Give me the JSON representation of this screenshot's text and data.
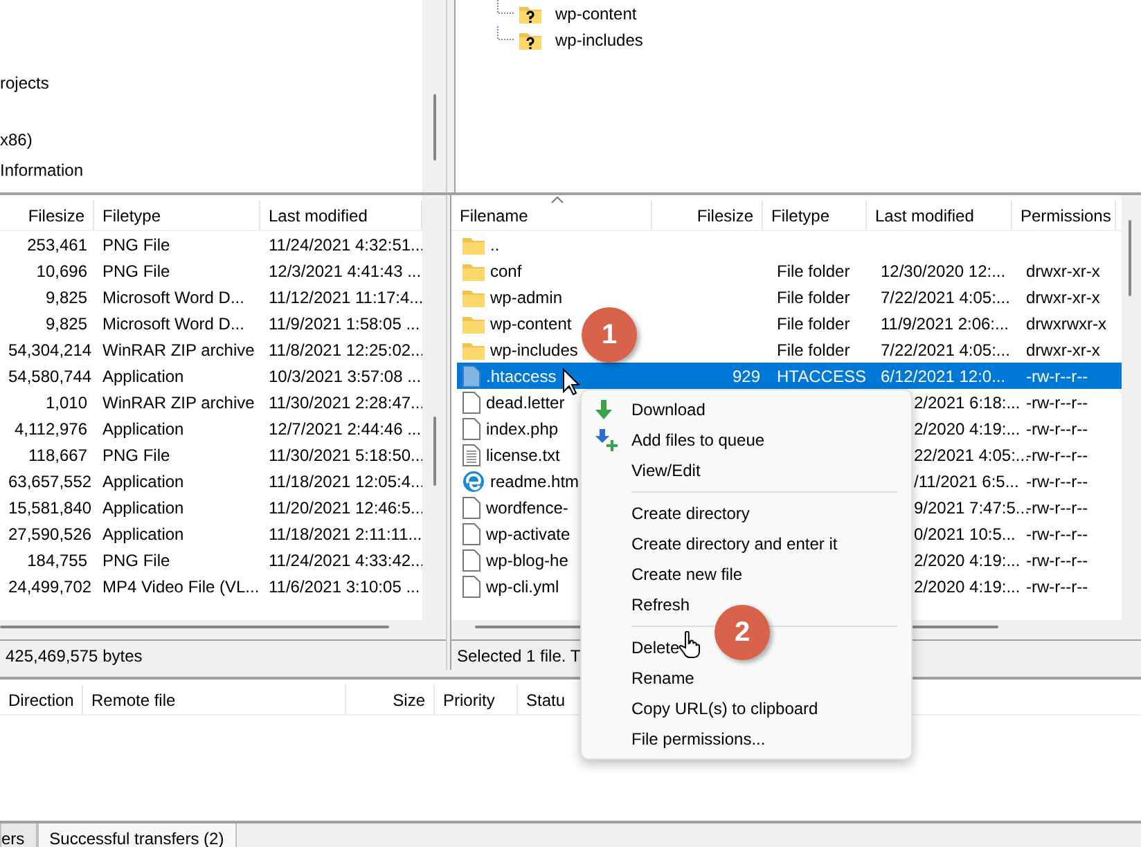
{
  "local_tree": {
    "items": [
      {
        "label": "rojects"
      },
      {
        "label": "x86)"
      },
      {
        "label": "Information"
      }
    ]
  },
  "remote_tree": {
    "items": [
      {
        "label": "wp-content"
      },
      {
        "label": "wp-includes"
      }
    ]
  },
  "local_list": {
    "columns": [
      "Filesize",
      "Filetype",
      "Last modified"
    ],
    "rows": [
      {
        "size": "253,461",
        "type": "PNG File",
        "modified": "11/24/2021 4:32:51..."
      },
      {
        "size": "10,696",
        "type": "PNG File",
        "modified": "12/3/2021 4:41:43 ..."
      },
      {
        "size": "9,825",
        "type": "Microsoft Word D...",
        "modified": "11/12/2021 11:17:4..."
      },
      {
        "size": "9,825",
        "type": "Microsoft Word D...",
        "modified": "11/9/2021 1:58:05 ..."
      },
      {
        "size": "54,304,214",
        "type": "WinRAR ZIP archive",
        "modified": "11/8/2021 12:25:02..."
      },
      {
        "size": "54,580,744",
        "type": "Application",
        "modified": "10/3/2021 3:57:08 ..."
      },
      {
        "size": "1,010",
        "type": "WinRAR ZIP archive",
        "modified": "11/30/2021 2:28:47..."
      },
      {
        "size": "4,112,976",
        "type": "Application",
        "modified": "12/7/2021 2:44:46 ..."
      },
      {
        "size": "118,667",
        "type": "PNG File",
        "modified": "11/30/2021 5:18:50..."
      },
      {
        "size": "63,657,552",
        "type": "Application",
        "modified": "11/18/2021 12:05:4..."
      },
      {
        "size": "15,581,840",
        "type": "Application",
        "modified": "11/20/2021 12:46:5..."
      },
      {
        "size": "27,590,526",
        "type": "Application",
        "modified": "11/18/2021 2:11:11..."
      },
      {
        "size": "184,755",
        "type": "PNG File",
        "modified": "11/24/2021 4:33:42..."
      },
      {
        "size": "24,499,702",
        "type": "MP4 Video File (VL...",
        "modified": "11/6/2021 3:10:05 ..."
      }
    ]
  },
  "local_status": "425,469,575 bytes",
  "remote_list": {
    "columns": [
      "Filename",
      "Filesize",
      "Filetype",
      "Last modified",
      "Permissions"
    ],
    "rows": [
      {
        "name": "..",
        "kind": "folder",
        "selected": false
      },
      {
        "name": "conf",
        "kind": "folder",
        "type": "File folder",
        "modified": "12/30/2020 12:...",
        "perms": "drwxr-xr-x",
        "selected": false
      },
      {
        "name": "wp-admin",
        "kind": "folder",
        "type": "File folder",
        "modified": "7/22/2021 4:05:...",
        "perms": "drwxr-xr-x",
        "selected": false
      },
      {
        "name": "wp-content",
        "kind": "folder",
        "type": "File folder",
        "modified": "11/9/2021 2:06:...",
        "perms": "drwxrwxr-x",
        "selected": false
      },
      {
        "name": "wp-includes",
        "kind": "folder",
        "type": "File folder",
        "modified": "7/22/2021 4:05:...",
        "perms": "drwxr-xr-x",
        "selected": false
      },
      {
        "name": ".htaccess",
        "kind": "config",
        "size": "929",
        "type": "HTACCESS",
        "modified": "6/12/2021 12:0...",
        "perms": "-rw-r--r--",
        "selected": true
      },
      {
        "name": "dead.letter",
        "kind": "file",
        "modified": "2/2021 6:18:...",
        "perms": "-rw-r--r--",
        "selected": false
      },
      {
        "name": "index.php",
        "kind": "file",
        "modified": "2/2020 4:19:...",
        "perms": "-rw-r--r--",
        "selected": false
      },
      {
        "name": "license.txt",
        "kind": "text",
        "modified": "22/2021 4:05:...",
        "perms": "-rw-r--r--",
        "selected": false
      },
      {
        "name": "readme.htm",
        "kind": "web",
        "modified": "/11/2021 6:5...",
        "perms": "-rw-r--r--",
        "selected": false
      },
      {
        "name": "wordfence-",
        "kind": "file",
        "modified": "9/2021 7:47:5...",
        "perms": "-rw-r--r--",
        "selected": false
      },
      {
        "name": "wp-activate",
        "kind": "file",
        "modified": "0/2021 10:5...",
        "perms": "-rw-r--r--",
        "selected": false
      },
      {
        "name": "wp-blog-he",
        "kind": "file",
        "modified": "2/2020 4:19:...",
        "perms": "-rw-r--r--",
        "selected": false
      },
      {
        "name": "wp-cli.yml",
        "kind": "file",
        "modified": "2/2020 4:19:...",
        "perms": "-rw-r--r--",
        "selected": false
      }
    ]
  },
  "remote_status": "Selected 1 file. T",
  "context_menu": {
    "items": [
      {
        "kind": "item",
        "label": "Download"
      },
      {
        "kind": "item",
        "label": "Add files to queue"
      },
      {
        "kind": "item",
        "label": "View/Edit"
      },
      {
        "kind": "separator"
      },
      {
        "kind": "item",
        "label": "Create directory"
      },
      {
        "kind": "item",
        "label": "Create directory and enter it"
      },
      {
        "kind": "item",
        "label": "Create new file"
      },
      {
        "kind": "item",
        "label": "Refresh"
      },
      {
        "kind": "separator"
      },
      {
        "kind": "item",
        "label": "Delete"
      },
      {
        "kind": "item",
        "label": "Rename"
      },
      {
        "kind": "item",
        "label": "Copy URL(s) to clipboard"
      },
      {
        "kind": "item",
        "label": "File permissions..."
      }
    ]
  },
  "queue": {
    "columns": [
      "Direction",
      "Remote file",
      "Size",
      "Priority",
      "Statu"
    ]
  },
  "queue_tabs": [
    {
      "label": "ers",
      "selected": false
    },
    {
      "label": "Successful transfers (2)",
      "selected": true
    }
  ],
  "step_markers": [
    "1",
    "2"
  ]
}
